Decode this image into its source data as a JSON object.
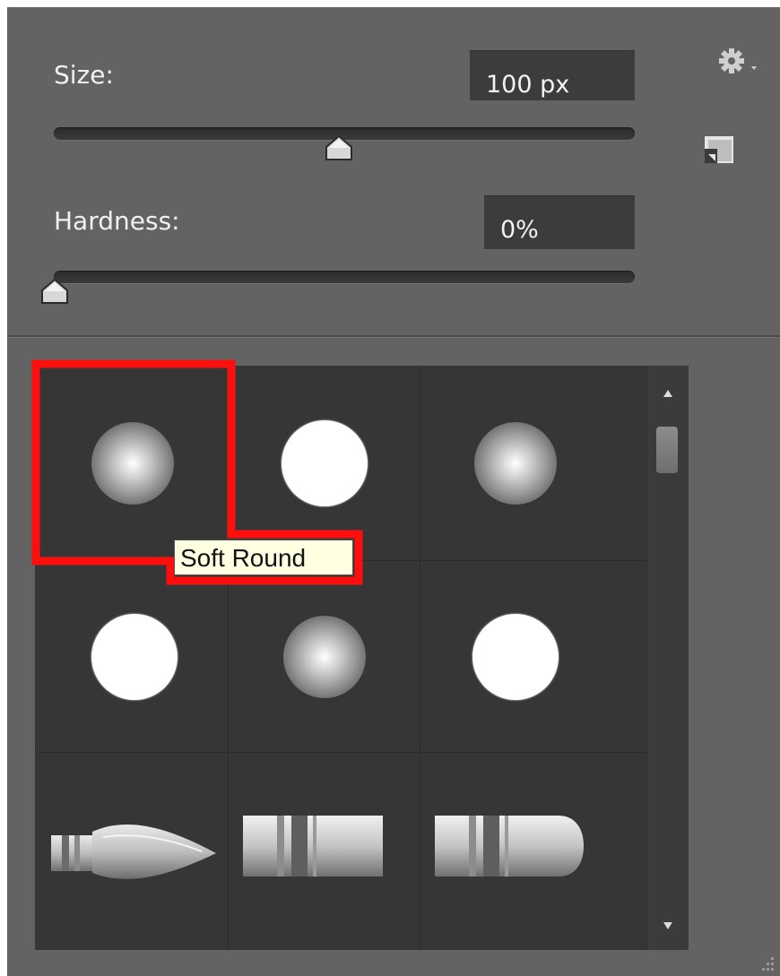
{
  "brush_panel": {
    "size_label": "Size:",
    "size_value": "100 px",
    "size_slider_position": 0.49,
    "hardness_label": "Hardness:",
    "hardness_value": "0%",
    "hardness_slider_position": 0.0,
    "icons": [
      "gear-icon",
      "brush-tip-icon"
    ]
  },
  "presets": [
    {
      "type": "soft-round"
    },
    {
      "type": "hard-round"
    },
    {
      "type": "soft-round"
    },
    {
      "type": "hard-round"
    },
    {
      "type": "soft-round"
    },
    {
      "type": "hard-round"
    },
    {
      "type": "pointed-bristle-brush"
    },
    {
      "type": "flat-bristle-brush"
    },
    {
      "type": "round-bristle-brush"
    }
  ],
  "tooltip": "Soft Round",
  "colors": {
    "panel_bg": "#636363",
    "grid_bg": "#363636",
    "highlight": "#ff1010",
    "tooltip_bg": "#ffffe1"
  }
}
